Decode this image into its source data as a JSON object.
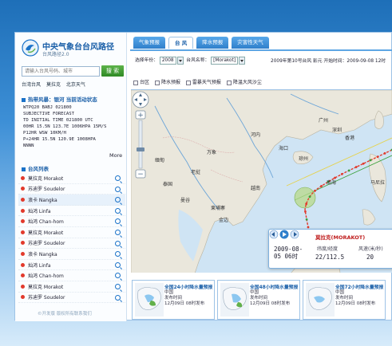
{
  "brand": {
    "title": "中央气象台台风路径",
    "subtitle": "台风路径2.0"
  },
  "search": {
    "placeholder": "请输入台风号码、城市",
    "button": "搜 索"
  },
  "quick_links": [
    "台湾台风",
    "莫拉克",
    "北京天气"
  ],
  "forecast_section": {
    "title": "热带风暴：银河 当前活动状态",
    "lines": [
      "WTPQ20 BABJ 021800",
      "SUBJECTIVE FORECAST",
      "TD INITIAL TIME 021800 UTC",
      "00HR 15.5N 123.7E 1006HPA 15M/S",
      "P12HR WSW 10KM/H",
      "P+24HR 15.5N 120.9E 1008HPA",
      "NNNN"
    ],
    "more": "More"
  },
  "typhoon_list": {
    "title": "台风列表",
    "items": [
      {
        "name": "莫拉克 Morakot",
        "selected": false
      },
      {
        "name": "苏迪罗 Soudelor",
        "selected": false
      },
      {
        "name": "浪卡 Nangka",
        "selected": true
      },
      {
        "name": "灿鸿 Linfa",
        "selected": false
      },
      {
        "name": "灿鸿 Chan-hom",
        "selected": false
      },
      {
        "name": "莫拉克 Morakot",
        "selected": false
      },
      {
        "name": "苏迪罗 Soudelor",
        "selected": false
      },
      {
        "name": "浪卡 Nangka",
        "selected": false
      },
      {
        "name": "灿鸿 Linfa",
        "selected": false
      },
      {
        "name": "灿鸿 Chan-hom",
        "selected": false
      },
      {
        "name": "莫拉克 Morakot",
        "selected": false
      },
      {
        "name": "苏迪罗 Soudelor",
        "selected": false
      }
    ]
  },
  "copyright": "©开发版  版权所有联系我们",
  "tabs": [
    {
      "label": "气象预报",
      "active": false
    },
    {
      "label": "台 风",
      "active": true
    },
    {
      "label": "降水预报",
      "active": false
    },
    {
      "label": "灾害性天气",
      "active": false
    }
  ],
  "controls": {
    "year_label": "选择年份：",
    "year_value": "2008",
    "name_label": "台风名称：",
    "name_value": "[Morakot]",
    "title_info": "2009年第10号台风 影元 开始时间：2009-09-08 12时"
  },
  "checkboxes": [
    "台区",
    "降水预报",
    "雷暴天气预报",
    "降温大风沙尘"
  ],
  "map_labels": [
    "广州",
    "深圳",
    "香港",
    "海口",
    "琼州",
    "河内",
    "万象",
    "曼谷",
    "金边",
    "南海",
    "马尼拉",
    "缅甸",
    "老挝",
    "泰国",
    "越南",
    "柬埔寨"
  ],
  "popup": {
    "typhoon_name": "莫拉克(MORAKOT)",
    "time_line1": "2009-08-",
    "time_line2": "05 06时",
    "coord_header": "纬度/经度",
    "coord_value": "22/112.5",
    "wind_header": "风速(米/秒)",
    "wind_value": "20"
  },
  "thumbnails": [
    {
      "title": "全国24小时降水量预报",
      "region": "中国",
      "issued": "发布时间",
      "time": "12月09日 08时发布"
    },
    {
      "title": "全国48小时降水量预报",
      "region": "中国",
      "issued": "发布时间",
      "time": "12月09日 08时发布"
    },
    {
      "title": "全国72小时降水量预报",
      "region": "中国",
      "issued": "发布时间",
      "time": "12月09日 08时发布"
    }
  ],
  "colors": {
    "brand_blue": "#1a5fa8",
    "track_red": "#e23a2c",
    "track_green": "#3aa03a"
  }
}
